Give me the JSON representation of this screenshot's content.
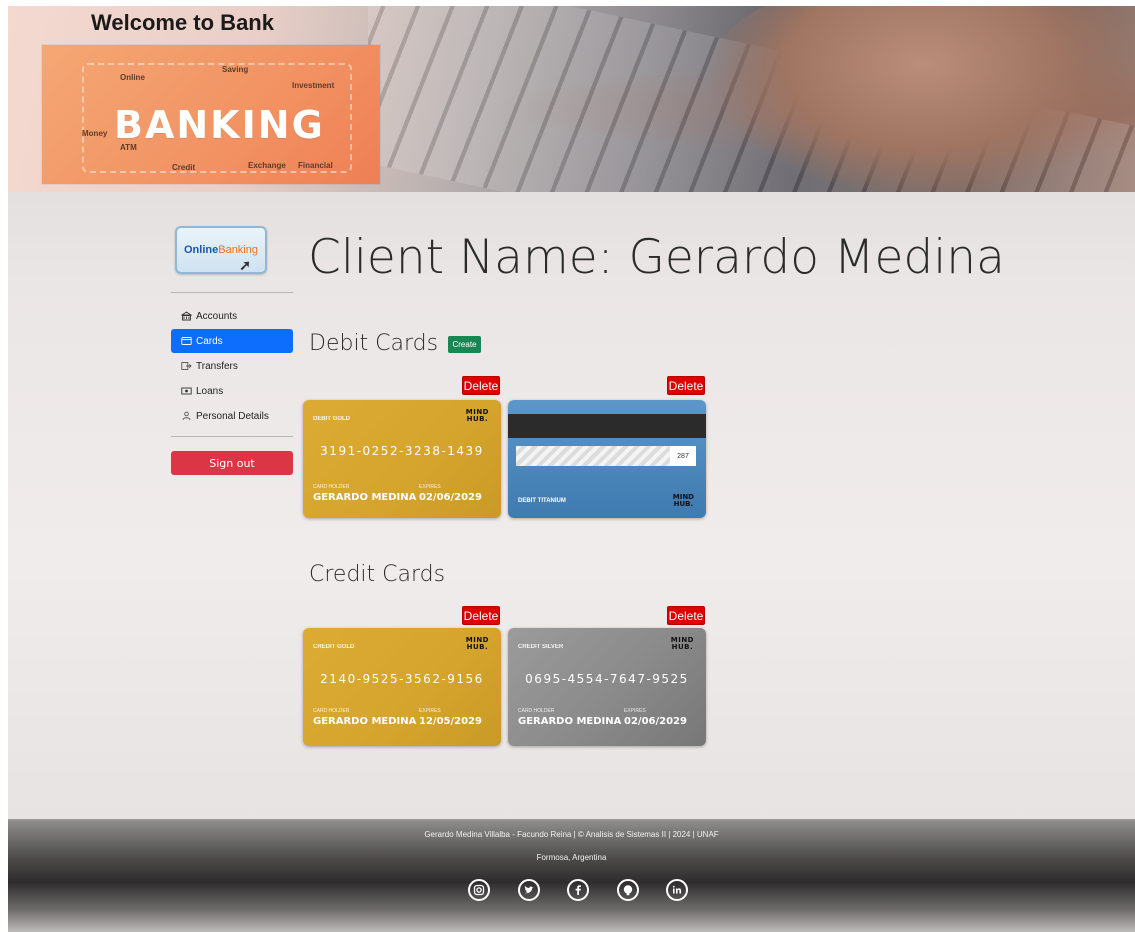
{
  "header": {
    "welcome": "Welcome to Bank",
    "banner_word": "BANKING",
    "banner_labels": [
      "Online",
      "Saving",
      "Investment",
      "Money",
      "ATM",
      "Credit",
      "Exchange",
      "Financial"
    ]
  },
  "sidebar": {
    "logo_online": "Online",
    "logo_banking": "Banking",
    "items": [
      {
        "label": "Accounts",
        "icon": "bank-icon",
        "active": false
      },
      {
        "label": "Cards",
        "icon": "card-icon",
        "active": true
      },
      {
        "label": "Transfers",
        "icon": "transfer-icon",
        "active": false
      },
      {
        "label": "Loans",
        "icon": "cash-icon",
        "active": false
      },
      {
        "label": "Personal Details",
        "icon": "person-icon",
        "active": false
      }
    ],
    "signout": "Sign out"
  },
  "main": {
    "client_title": "Client Name: Gerardo Medina",
    "debit_title": "Debit Cards",
    "create_label": "Create",
    "credit_title": "Credit Cards",
    "delete_label": "Delete",
    "debit_cards": [
      {
        "type": "DEBIT GOLD",
        "number": "3191-0252-3238-1439",
        "holder_label": "CARD HOLDER",
        "holder": "GERARDO MEDINA",
        "expires_label": "EXPIRES",
        "expires": "02/06/2029",
        "color": "gold"
      },
      {
        "type": "DEBIT TITANIUM",
        "cvv": "287",
        "color": "titanium",
        "flipped": true
      }
    ],
    "credit_cards": [
      {
        "type": "CREDIT GOLD",
        "number": "2140-9525-3562-9156",
        "holder_label": "CARD HOLDER",
        "holder": "GERARDO MEDINA",
        "expires_label": "EXPIRES",
        "expires": "12/05/2029",
        "color": "gold"
      },
      {
        "type": "CREDIT SILVER",
        "number": "0695-4554-7647-9525",
        "holder_label": "CARD HOLDER",
        "holder": "GERARDO MEDINA",
        "expires_label": "EXPIRES",
        "expires": "02/06/2029",
        "color": "silver"
      }
    ],
    "card_logo_top": "MIND",
    "card_logo_bottom": "HUB."
  },
  "footer": {
    "credits": "Gerardo Medina Villalba - Facundo Reina | © Analisis de Sistemas II | 2024 | UNAF",
    "location": "Formosa, Argentina",
    "socials": [
      "instagram-icon",
      "twitter-icon",
      "facebook-icon",
      "github-icon",
      "linkedin-icon"
    ]
  }
}
